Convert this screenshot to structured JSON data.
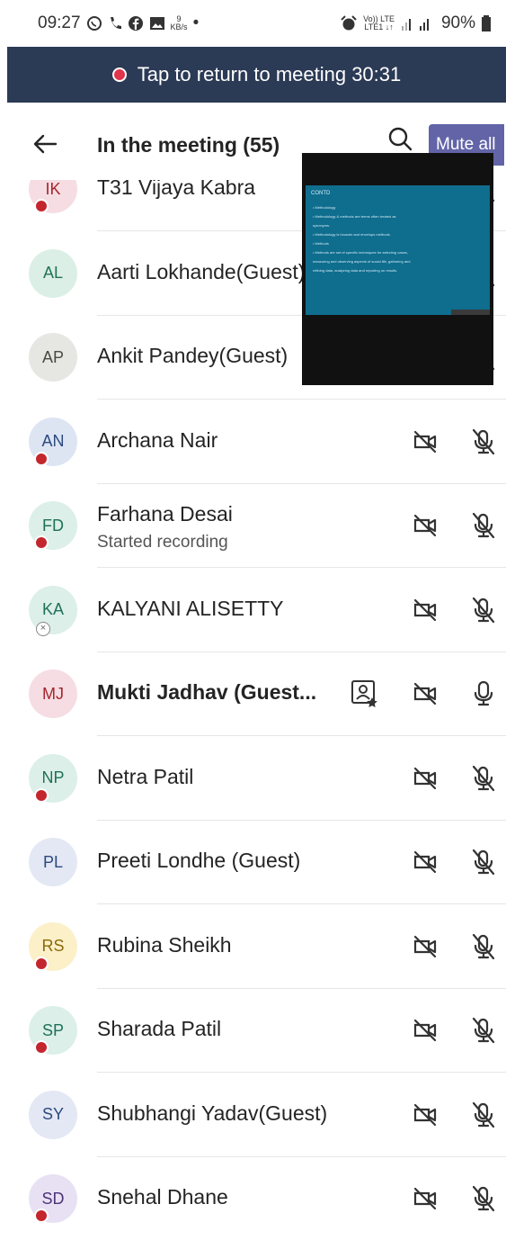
{
  "status_bar": {
    "time": "09:27",
    "icons": [
      "whatsapp-icon",
      "call-icon",
      "facebook-icon",
      "gallery-icon"
    ],
    "data_rate_value": "9",
    "data_rate_unit": "KB/s",
    "dot": "•",
    "network_line1": "Vo)) LTE",
    "network_line2": "LTE1 ↓↑",
    "battery": "90%"
  },
  "banner": {
    "text": "Tap to return to meeting 30:31",
    "dot_color": "#e0334c",
    "background": "#2b3a55"
  },
  "header": {
    "title": "In the meeting (55)",
    "mute_all_label": "Mute all",
    "accent": "#6264a7"
  },
  "overlay_slide": {
    "heading": "CONTD",
    "lines": [
      "• Methodology",
      "• Methodology & methods are terms often treated as",
      "  synonyms.",
      "• Methodology is broader and envelops methods.",
      "• Methods",
      "• Methods are set of specific techniques for selecting cases,",
      "  measuring and observing aspects of social life, gathering and",
      "  refining data, analyzing data and reporting on results."
    ]
  },
  "participants": [
    {
      "initials": "IK",
      "name": "T31 Vijaya Kabra",
      "status": "",
      "avatar_bg": "#f6dde3",
      "avatar_fg": "#a4262c",
      "badge": "red",
      "role": false,
      "cam_off": true,
      "mic": "muted"
    },
    {
      "initials": "AL",
      "name": "Aarti Lokhande(Guest)",
      "status": "",
      "avatar_bg": "#dbefe6",
      "avatar_fg": "#23725a",
      "badge": "none",
      "role": false,
      "cam_off": true,
      "mic": "muted"
    },
    {
      "initials": "AP",
      "name": "Ankit Pandey(Guest)",
      "status": "",
      "avatar_bg": "#e6e7e2",
      "avatar_fg": "#4a4a42",
      "badge": "none",
      "role": false,
      "cam_off": true,
      "mic": "muted"
    },
    {
      "initials": "AN",
      "name": "Archana Nair",
      "status": "",
      "avatar_bg": "#dde5f3",
      "avatar_fg": "#2c4a7e",
      "badge": "red",
      "role": false,
      "cam_off": true,
      "mic": "muted"
    },
    {
      "initials": "FD",
      "name": "Farhana Desai",
      "status": "Started recording",
      "avatar_bg": "#dcefe8",
      "avatar_fg": "#1f7158",
      "badge": "red",
      "role": false,
      "cam_off": true,
      "mic": "muted"
    },
    {
      "initials": "KA",
      "name": "KALYANI ALISETTY",
      "status": "",
      "avatar_bg": "#dcefe8",
      "avatar_fg": "#1f7158",
      "badge": "x",
      "role": false,
      "cam_off": true,
      "mic": "muted"
    },
    {
      "initials": "MJ",
      "name": "Mukti Jadhav (Guest...",
      "status": "",
      "avatar_bg": "#f6dde3",
      "avatar_fg": "#a4262c",
      "badge": "none",
      "role": true,
      "cam_off": true,
      "mic": "on",
      "bold": true
    },
    {
      "initials": "NP",
      "name": "Netra Patil",
      "status": "",
      "avatar_bg": "#dcefe8",
      "avatar_fg": "#1f7158",
      "badge": "red",
      "role": false,
      "cam_off": true,
      "mic": "muted"
    },
    {
      "initials": "PL",
      "name": "Preeti Londhe (Guest)",
      "status": "",
      "avatar_bg": "#e3e8f4",
      "avatar_fg": "#2c4a7e",
      "badge": "none",
      "role": false,
      "cam_off": true,
      "mic": "muted"
    },
    {
      "initials": "RS",
      "name": "Rubina Sheikh",
      "status": "",
      "avatar_bg": "#fbf0c8",
      "avatar_fg": "#8a6a0a",
      "badge": "red",
      "role": false,
      "cam_off": true,
      "mic": "muted"
    },
    {
      "initials": "SP",
      "name": "Sharada Patil",
      "status": "",
      "avatar_bg": "#dcefe8",
      "avatar_fg": "#1f7158",
      "badge": "red",
      "role": false,
      "cam_off": true,
      "mic": "muted"
    },
    {
      "initials": "SY",
      "name": "Shubhangi Yadav(Guest)",
      "status": "",
      "avatar_bg": "#e3e8f4",
      "avatar_fg": "#2c4a7e",
      "badge": "none",
      "role": false,
      "cam_off": true,
      "mic": "muted"
    },
    {
      "initials": "SD",
      "name": "Snehal Dhane",
      "status": "",
      "avatar_bg": "#e8e1f3",
      "avatar_fg": "#4b3478",
      "badge": "red",
      "role": false,
      "cam_off": true,
      "mic": "muted"
    }
  ]
}
